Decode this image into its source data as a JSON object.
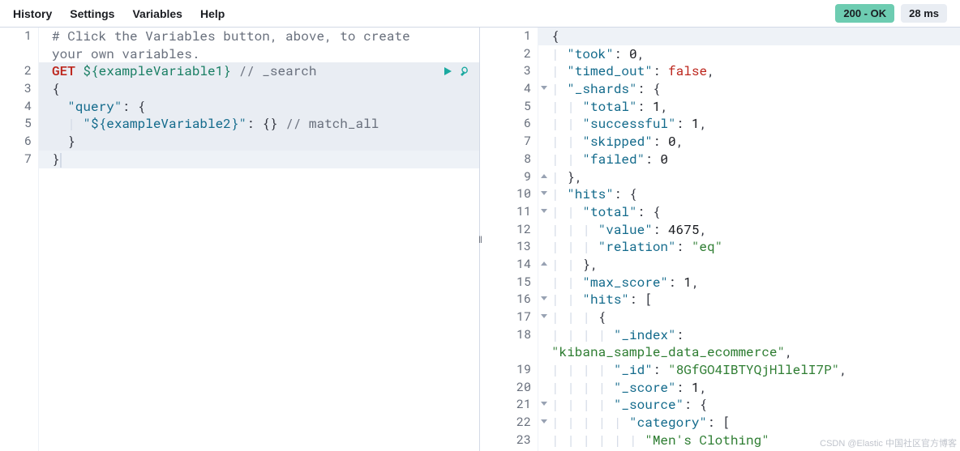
{
  "toolbar": {
    "history": "History",
    "settings": "Settings",
    "variables": "Variables",
    "help": "Help"
  },
  "status": {
    "code_label": "200 - OK",
    "time_label": "28 ms"
  },
  "request": {
    "lines": [
      {
        "n": "1",
        "fold": "",
        "raw": "# Click the Variables button, above, to create your own variables."
      },
      {
        "n": "2",
        "fold": "",
        "method": "GET",
        "endpoint": "${exampleVariable1}",
        "after": " // _search"
      },
      {
        "n": "3",
        "fold": "open",
        "raw": "{"
      },
      {
        "n": "4",
        "fold": "open",
        "key": "query",
        "after": ": {"
      },
      {
        "n": "5",
        "fold": "",
        "key": "${exampleVariable2}",
        "after": ": {} // match_all"
      },
      {
        "n": "6",
        "fold": "close",
        "raw": "  }"
      },
      {
        "n": "7",
        "fold": "close",
        "raw": "}"
      }
    ]
  },
  "response": {
    "lines": [
      {
        "n": "1",
        "fold": "open",
        "t": [
          [
            "punc",
            "{"
          ]
        ]
      },
      {
        "n": "2",
        "fold": "",
        "t": [
          [
            "sp",
            "  "
          ],
          [
            "key",
            "\"took\""
          ],
          [
            "punc",
            ": "
          ],
          [
            "num",
            "0"
          ],
          [
            "punc",
            ","
          ]
        ]
      },
      {
        "n": "3",
        "fold": "",
        "t": [
          [
            "sp",
            "  "
          ],
          [
            "key",
            "\"timed_out\""
          ],
          [
            "punc",
            ": "
          ],
          [
            "bool",
            "false"
          ],
          [
            "punc",
            ","
          ]
        ]
      },
      {
        "n": "4",
        "fold": "open",
        "t": [
          [
            "sp",
            "  "
          ],
          [
            "key",
            "\"_shards\""
          ],
          [
            "punc",
            ": {"
          ]
        ]
      },
      {
        "n": "5",
        "fold": "",
        "t": [
          [
            "sp",
            "    "
          ],
          [
            "key",
            "\"total\""
          ],
          [
            "punc",
            ": "
          ],
          [
            "num",
            "1"
          ],
          [
            "punc",
            ","
          ]
        ]
      },
      {
        "n": "6",
        "fold": "",
        "t": [
          [
            "sp",
            "    "
          ],
          [
            "key",
            "\"successful\""
          ],
          [
            "punc",
            ": "
          ],
          [
            "num",
            "1"
          ],
          [
            "punc",
            ","
          ]
        ]
      },
      {
        "n": "7",
        "fold": "",
        "t": [
          [
            "sp",
            "    "
          ],
          [
            "key",
            "\"skipped\""
          ],
          [
            "punc",
            ": "
          ],
          [
            "num",
            "0"
          ],
          [
            "punc",
            ","
          ]
        ]
      },
      {
        "n": "8",
        "fold": "",
        "t": [
          [
            "sp",
            "    "
          ],
          [
            "key",
            "\"failed\""
          ],
          [
            "punc",
            ": "
          ],
          [
            "num",
            "0"
          ]
        ]
      },
      {
        "n": "9",
        "fold": "close",
        "t": [
          [
            "sp",
            "  "
          ],
          [
            "punc",
            "},"
          ]
        ]
      },
      {
        "n": "10",
        "fold": "open",
        "t": [
          [
            "sp",
            "  "
          ],
          [
            "key",
            "\"hits\""
          ],
          [
            "punc",
            ": {"
          ]
        ]
      },
      {
        "n": "11",
        "fold": "open",
        "t": [
          [
            "sp",
            "    "
          ],
          [
            "key",
            "\"total\""
          ],
          [
            "punc",
            ": {"
          ]
        ]
      },
      {
        "n": "12",
        "fold": "",
        "t": [
          [
            "sp",
            "      "
          ],
          [
            "key",
            "\"value\""
          ],
          [
            "punc",
            ": "
          ],
          [
            "num",
            "4675"
          ],
          [
            "punc",
            ","
          ]
        ]
      },
      {
        "n": "13",
        "fold": "",
        "t": [
          [
            "sp",
            "      "
          ],
          [
            "key",
            "\"relation\""
          ],
          [
            "punc",
            ": "
          ],
          [
            "str",
            "\"eq\""
          ]
        ]
      },
      {
        "n": "14",
        "fold": "close",
        "t": [
          [
            "sp",
            "    "
          ],
          [
            "punc",
            "},"
          ]
        ]
      },
      {
        "n": "15",
        "fold": "",
        "t": [
          [
            "sp",
            "    "
          ],
          [
            "key",
            "\"max_score\""
          ],
          [
            "punc",
            ": "
          ],
          [
            "num",
            "1"
          ],
          [
            "punc",
            ","
          ]
        ]
      },
      {
        "n": "16",
        "fold": "open",
        "t": [
          [
            "sp",
            "    "
          ],
          [
            "key",
            "\"hits\""
          ],
          [
            "punc",
            ": ["
          ]
        ]
      },
      {
        "n": "17",
        "fold": "open",
        "t": [
          [
            "sp",
            "      "
          ],
          [
            "punc",
            "{"
          ]
        ]
      },
      {
        "n": "18",
        "fold": "",
        "wrap2": true,
        "t": [
          [
            "sp",
            "        "
          ],
          [
            "key",
            "\"_index\""
          ],
          [
            "punc",
            ": "
          ],
          [
            "str",
            "\"kibana_sample_data_ecommerce\""
          ],
          [
            "punc",
            ","
          ]
        ]
      },
      {
        "n": "19",
        "fold": "",
        "t": [
          [
            "sp",
            "        "
          ],
          [
            "key",
            "\"_id\""
          ],
          [
            "punc",
            ": "
          ],
          [
            "str",
            "\"8GfGO4IBTYQjHllelI7P\""
          ],
          [
            "punc",
            ","
          ]
        ]
      },
      {
        "n": "20",
        "fold": "",
        "t": [
          [
            "sp",
            "        "
          ],
          [
            "key",
            "\"_score\""
          ],
          [
            "punc",
            ": "
          ],
          [
            "num",
            "1"
          ],
          [
            "punc",
            ","
          ]
        ]
      },
      {
        "n": "21",
        "fold": "open",
        "t": [
          [
            "sp",
            "        "
          ],
          [
            "key",
            "\"_source\""
          ],
          [
            "punc",
            ": {"
          ]
        ]
      },
      {
        "n": "22",
        "fold": "open",
        "t": [
          [
            "sp",
            "          "
          ],
          [
            "key",
            "\"category\""
          ],
          [
            "punc",
            ": ["
          ]
        ]
      },
      {
        "n": "23",
        "fold": "",
        "t": [
          [
            "sp",
            "            "
          ],
          [
            "str",
            "\"Men's Clothing\""
          ]
        ]
      }
    ]
  },
  "watermark": "CSDN @Elastic 中国社区官方博客"
}
